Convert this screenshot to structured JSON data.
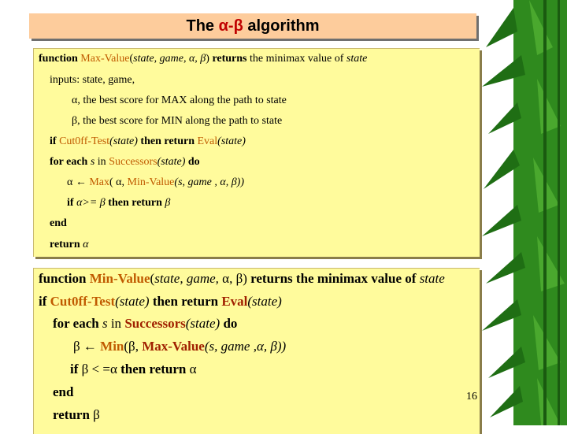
{
  "slide": {
    "title_prefix": "The ",
    "title_alpha": "α",
    "title_dash": "-",
    "title_beta": "β",
    "title_suffix": " algorithm",
    "page_number": "16",
    "colors": {
      "title_bg": "#fdcc9c",
      "box_bg": "#fffb9c",
      "function_name": "#c05a00",
      "greek_title": "#c00000"
    }
  },
  "max_value": {
    "l1": {
      "kw1": "function",
      "fn": "Max-Value",
      "p1": "(",
      "args": "state, game,  α, β",
      "p2": ")",
      "kw2": " returns",
      "rest": " the minimax value of ",
      "state": "state"
    },
    "l2": "inputs: state, game,",
    "l3": "α, the best score for MAX along the path to state",
    "l4": "β, the best score for MIN along the path to state",
    "l5": {
      "kw1": "if  ",
      "fn1": "Cut0ff-Test",
      "a1": "(state)",
      "kw2": " then return ",
      "fn2": "Eval",
      "a2": "(state)"
    },
    "l6": {
      "kw1": "for each ",
      "s": "s",
      "in": " in ",
      "fn": "Successors",
      "a": "(state)",
      "kw2": " do"
    },
    "l7": {
      "lhs": "α ← ",
      "fn1": "Max",
      "a1": "( α, ",
      "fn2": "Min-Value",
      "a2": "(s, game , α, β))"
    },
    "l8": {
      "kw1": "if ",
      "cond": "α>= β",
      "kw2": "  then return ",
      "ret": " β"
    },
    "l9": "end",
    "l10": {
      "kw": "return ",
      "val": "α"
    }
  },
  "min_value": {
    "l1": {
      "kw1": "function ",
      "fn": "Min-Value",
      "p1": "(",
      "args": "state, game, ",
      "ab": "α, β",
      "p2": ")",
      "kw2": " returns the minimax value of ",
      "state": "state"
    },
    "l2": {
      "kw1": "if  ",
      "fn1": "Cut0ff-Test",
      "a1": "(state)",
      "kw2": " then return ",
      "fn2": "Eval",
      "a2": "(state)"
    },
    "l3": {
      "kw1": "for each ",
      "s": "s",
      "in": " in ",
      "fn": "Successors",
      "a": "(state)",
      "kw2": " do"
    },
    "l4": {
      "lhs": "β ← ",
      "fn1": "Min",
      "a1": "(β, ",
      "fn2": "Max-Value",
      "a2": "(s, game ,α, β))"
    },
    "l5": {
      "kw1": "if ",
      "cond": "β < =α",
      "kw2": " then return ",
      "ret": "α"
    },
    "l6": "end",
    "l7": {
      "kw": "return ",
      "val": "β"
    }
  }
}
